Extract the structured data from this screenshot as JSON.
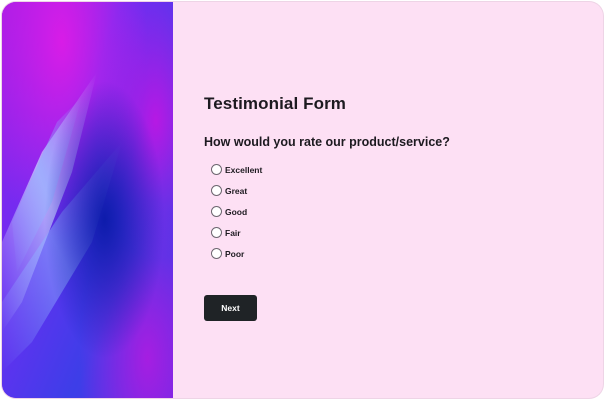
{
  "form": {
    "title": "Testimonial Form",
    "question": "How would you rate our product/service?",
    "options": [
      {
        "label": "Excellent",
        "selected": false
      },
      {
        "label": "Great",
        "selected": false
      },
      {
        "label": "Good",
        "selected": false
      },
      {
        "label": "Fair",
        "selected": false
      },
      {
        "label": "Poor",
        "selected": false
      }
    ],
    "next_label": "Next"
  },
  "colors": {
    "panel_background": "#fde0f4",
    "button_background": "#1f2326",
    "text": "#1d1a20",
    "hero_primary": "#7a2ff0",
    "hero_accent": "#c513e0"
  }
}
